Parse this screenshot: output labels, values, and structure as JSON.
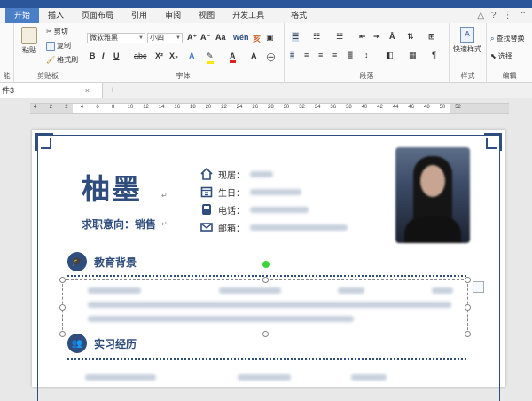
{
  "menu": {
    "tabs": [
      "开始",
      "插入",
      "页面布局",
      "引用",
      "审阅",
      "视图",
      "开发工具",
      "格式"
    ],
    "active_tab": "开始"
  },
  "ribbon": {
    "clipboard": {
      "label": "剪贴板",
      "paste": "粘贴",
      "cut": "剪切",
      "copy": "复制",
      "format_painter": "格式刷"
    },
    "font": {
      "label": "字体",
      "family": "微软雅黑",
      "size": "小四"
    },
    "paragraph": {
      "label": "段落"
    },
    "styles": {
      "label": "样式",
      "quick_styles": "快速样式"
    },
    "editing": {
      "label": "编辑",
      "find_replace": "查找替换",
      "select": "选择"
    },
    "left_partial_label": "能"
  },
  "doc_tab": {
    "title": "件3"
  },
  "ruler": {
    "ticks": [
      "4",
      "2",
      "2",
      "4",
      "6",
      "8",
      "10",
      "12",
      "14",
      "16",
      "18",
      "20",
      "22",
      "24",
      "26",
      "28",
      "30",
      "32",
      "34",
      "36",
      "38",
      "40",
      "42",
      "44",
      "46",
      "48",
      "50",
      "52"
    ]
  },
  "resume": {
    "name": "柚墨",
    "intent": "求职意向：销售",
    "info": [
      {
        "icon": "home-icon",
        "label": "现居："
      },
      {
        "icon": "calendar-icon",
        "label": "生日："
      },
      {
        "icon": "phone-icon",
        "label": "电话："
      },
      {
        "icon": "mail-icon",
        "label": "邮箱："
      }
    ],
    "sections": [
      {
        "icon": "graduation-cap-icon",
        "title": "教育背景"
      },
      {
        "icon": "people-icon",
        "title": "实习经历"
      }
    ]
  },
  "colors": {
    "accent": "#2f4d7d",
    "tab_active": "#4a7ec7",
    "selection_handle": "#3bd23b"
  }
}
